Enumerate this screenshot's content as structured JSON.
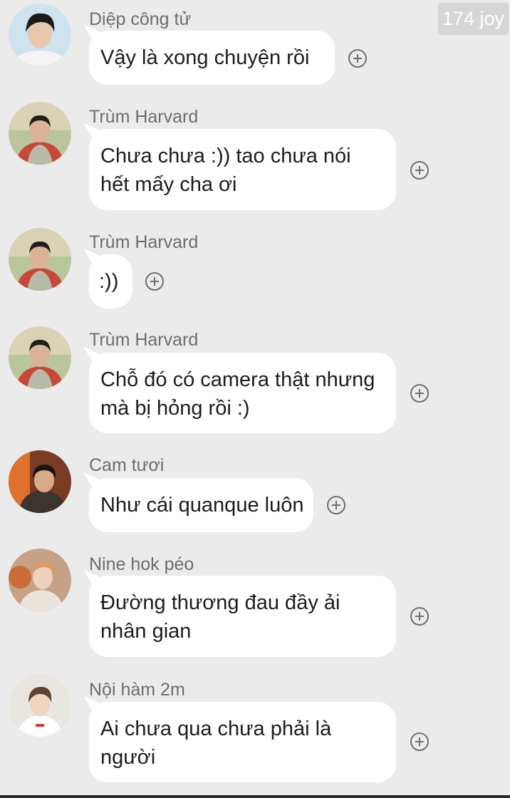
{
  "watermark": "174 joy",
  "colors": {
    "background": "#ebebeb",
    "bubble": "#ffffff",
    "sender_text": "#6e6e6e",
    "message_text": "#1c1c1c"
  },
  "messages": [
    {
      "sender": "Diệp công tử",
      "text": "Vậy là xong chuyện rồi",
      "avatar": "avatar-photo",
      "react_icon": "add-reaction-icon"
    },
    {
      "sender": "Trùm Harvard",
      "text": "Chưa chưa :)) tao chưa nói hết mấy cha ơi",
      "avatar": "avatar-photo",
      "react_icon": "add-reaction-icon"
    },
    {
      "sender": "Trùm Harvard",
      "text": ":))",
      "avatar": "avatar-photo",
      "react_icon": "add-reaction-icon"
    },
    {
      "sender": "Trùm Harvard",
      "text": "Chỗ đó có camera thật nhưng mà bị hỏng rồi :)",
      "avatar": "avatar-photo",
      "react_icon": "add-reaction-icon"
    },
    {
      "sender": "Cam tươi",
      "text": "Như cái quanque luôn",
      "avatar": "avatar-photo",
      "react_icon": "add-reaction-icon"
    },
    {
      "sender": "Nine hok péo",
      "text": "Đường thương đau đầy ải nhân gian",
      "avatar": "avatar-photo",
      "react_icon": "add-reaction-icon"
    },
    {
      "sender": "Nội hàm 2m",
      "text": "Ai chưa qua chưa phải là người",
      "avatar": "avatar-photo",
      "react_icon": "add-reaction-icon"
    }
  ]
}
